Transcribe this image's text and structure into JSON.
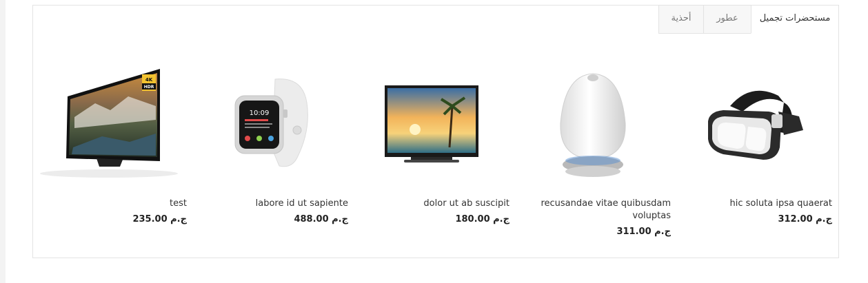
{
  "tabs": [
    {
      "label": "مستحضرات تجميل",
      "active": true
    },
    {
      "label": "عطور",
      "active": false
    },
    {
      "label": "أحذية",
      "active": false
    }
  ],
  "products": [
    {
      "name": "hic soluta ipsa quaerat",
      "price": "312.00 ج.م",
      "image": "vr-headset-icon"
    },
    {
      "name": "recusandae vitae quibusdam voluptas",
      "price": "311.00 ج.م",
      "image": "smart-speaker-icon"
    },
    {
      "name": "dolor ut ab suscipit",
      "price": "180.00 ج.م",
      "image": "monitor-tv-icon"
    },
    {
      "name": "labore id ut sapiente",
      "price": "488.00 ج.م",
      "image": "smartwatch-icon"
    },
    {
      "name": "test",
      "price": "235.00 ج.م",
      "image": "4k-tv-icon"
    }
  ],
  "tv_badge": {
    "line1": "4K",
    "line2": "HDR"
  },
  "watch_screen": {
    "time": "10:09"
  },
  "colors": {
    "border": "#e3e3e3",
    "tab_bg": "#f7f7f7",
    "text": "#333333"
  }
}
